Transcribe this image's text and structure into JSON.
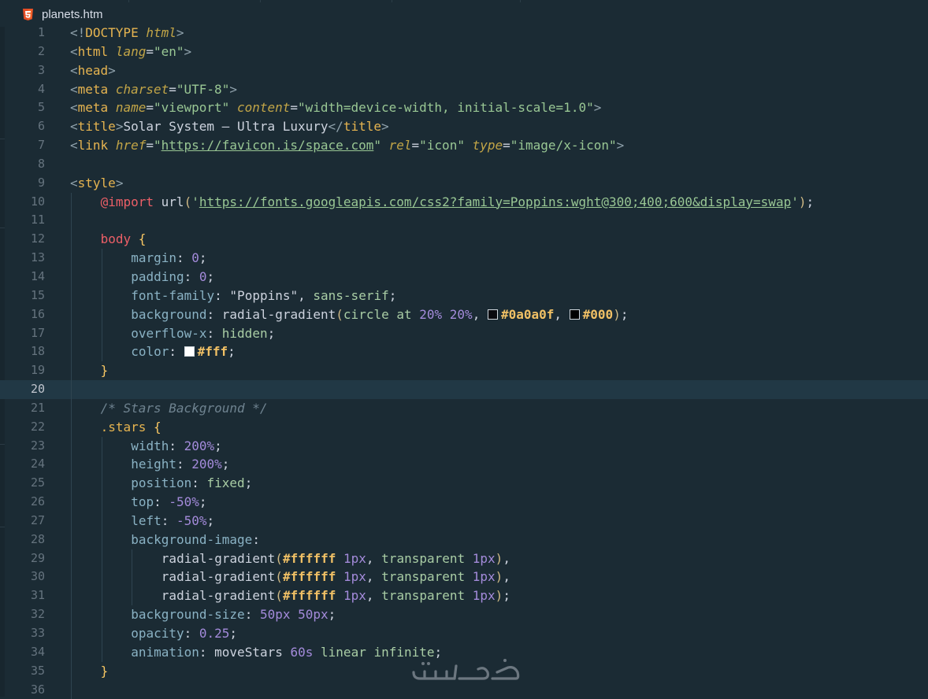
{
  "tab": {
    "title": "planets.htm",
    "icon": "html5-icon"
  },
  "colors": {
    "background": "#1b2b34",
    "current_line": "#213845",
    "line_number": "#65737e",
    "tag": "#e6b450",
    "attribute": "#c2a547",
    "string": "#99c794",
    "property": "#8ab2c4",
    "number": "#a48bdb",
    "hex": "#f0c065",
    "comment": "#6f8390",
    "keyword": "#ec5f67"
  },
  "current_line": 20,
  "lines": [
    {
      "n": "1",
      "tokens": [
        [
          "brk",
          "<!"
        ],
        [
          "tag",
          "DOCTYPE "
        ],
        [
          "attr",
          "html"
        ],
        [
          "brk",
          ">"
        ]
      ]
    },
    {
      "n": "2",
      "tokens": [
        [
          "brk",
          "<"
        ],
        [
          "tag",
          "html "
        ],
        [
          "attr",
          "lang"
        ],
        [
          "plain",
          "="
        ],
        [
          "str",
          "\"en\""
        ],
        [
          "brk",
          ">"
        ]
      ]
    },
    {
      "n": "3",
      "tokens": [
        [
          "brk",
          "<"
        ],
        [
          "tag",
          "head"
        ],
        [
          "brk",
          ">"
        ]
      ]
    },
    {
      "n": "4",
      "tokens": [
        [
          "brk",
          "<"
        ],
        [
          "tag",
          "meta "
        ],
        [
          "attr",
          "charset"
        ],
        [
          "plain",
          "="
        ],
        [
          "str",
          "\"UTF-8\""
        ],
        [
          "brk",
          ">"
        ]
      ]
    },
    {
      "n": "5",
      "tokens": [
        [
          "brk",
          "<"
        ],
        [
          "tag",
          "meta "
        ],
        [
          "attr",
          "name"
        ],
        [
          "plain",
          "="
        ],
        [
          "str",
          "\"viewport\" "
        ],
        [
          "attr",
          "content"
        ],
        [
          "plain",
          "="
        ],
        [
          "str",
          "\"width=device-width, initial-scale=1.0\""
        ],
        [
          "brk",
          ">"
        ]
      ]
    },
    {
      "n": "6",
      "tokens": [
        [
          "brk",
          "<"
        ],
        [
          "tag",
          "title"
        ],
        [
          "brk",
          ">"
        ],
        [
          "plain",
          "Solar System – Ultra Luxury"
        ],
        [
          "brk",
          "</"
        ],
        [
          "tag",
          "title"
        ],
        [
          "brk",
          ">"
        ]
      ]
    },
    {
      "n": "7",
      "tokens": [
        [
          "brk",
          "<"
        ],
        [
          "tag",
          "link "
        ],
        [
          "attr",
          "href"
        ],
        [
          "plain",
          "="
        ],
        [
          "str",
          "\""
        ],
        [
          "url",
          "https://favicon.is/space.com"
        ],
        [
          "str",
          "\" "
        ],
        [
          "attr",
          "rel"
        ],
        [
          "plain",
          "="
        ],
        [
          "str",
          "\"icon\" "
        ],
        [
          "attr",
          "type"
        ],
        [
          "plain",
          "="
        ],
        [
          "str",
          "\"image/x-icon\""
        ],
        [
          "brk",
          ">"
        ]
      ]
    },
    {
      "n": "8",
      "tokens": []
    },
    {
      "n": "9",
      "tokens": [
        [
          "brk",
          "<"
        ],
        [
          "tag",
          "style"
        ],
        [
          "brk",
          ">"
        ]
      ]
    },
    {
      "n": "10",
      "indent": 1,
      "tokens": [
        [
          "kw",
          "@import "
        ],
        [
          "fn",
          "url"
        ],
        [
          "paren",
          "("
        ],
        [
          "str",
          "'"
        ],
        [
          "url",
          "https://fonts.googleapis.com/css2?family=Poppins:wght@300;400;600&display=swap"
        ],
        [
          "str",
          "'"
        ],
        [
          "paren",
          ")"
        ],
        [
          "plain",
          ";"
        ]
      ]
    },
    {
      "n": "11",
      "tokens": []
    },
    {
      "n": "12",
      "indent": 1,
      "tokens": [
        [
          "kw",
          "body "
        ],
        [
          "brace",
          "{"
        ]
      ]
    },
    {
      "n": "13",
      "indent": 2,
      "tokens": [
        [
          "prop",
          "margin"
        ],
        [
          "plain",
          ": "
        ],
        [
          "num",
          "0"
        ],
        [
          "plain",
          ";"
        ]
      ]
    },
    {
      "n": "14",
      "indent": 2,
      "tokens": [
        [
          "prop",
          "padding"
        ],
        [
          "plain",
          ": "
        ],
        [
          "num",
          "0"
        ],
        [
          "plain",
          ";"
        ]
      ]
    },
    {
      "n": "15",
      "indent": 2,
      "tokens": [
        [
          "prop",
          "font-family"
        ],
        [
          "plain",
          ": "
        ],
        [
          "plain",
          "\"Poppins\", "
        ],
        [
          "val",
          "sans-serif"
        ],
        [
          "plain",
          ";"
        ]
      ]
    },
    {
      "n": "16",
      "indent": 2,
      "tokens": [
        [
          "prop",
          "background"
        ],
        [
          "plain",
          ": "
        ],
        [
          "fn",
          "radial-gradient"
        ],
        [
          "paren",
          "("
        ],
        [
          "val",
          "circle at "
        ],
        [
          "num",
          "20% 20%"
        ],
        [
          "plain",
          ", "
        ],
        [
          "swatch",
          "#0a0a0f"
        ],
        [
          "hex",
          "#0a0a0f"
        ],
        [
          "plain",
          ", "
        ],
        [
          "swatch",
          "#000"
        ],
        [
          "hex",
          "#000"
        ],
        [
          "paren",
          ")"
        ],
        [
          "plain",
          ";"
        ]
      ]
    },
    {
      "n": "17",
      "indent": 2,
      "tokens": [
        [
          "prop",
          "overflow-x"
        ],
        [
          "plain",
          ": "
        ],
        [
          "val",
          "hidden"
        ],
        [
          "plain",
          ";"
        ]
      ]
    },
    {
      "n": "18",
      "indent": 2,
      "tokens": [
        [
          "prop",
          "color"
        ],
        [
          "plain",
          ": "
        ],
        [
          "swatch",
          "#ffffff"
        ],
        [
          "hex",
          "#fff"
        ],
        [
          "plain",
          ";"
        ]
      ]
    },
    {
      "n": "19",
      "indent": 1,
      "tokens": [
        [
          "brace",
          "}"
        ]
      ]
    },
    {
      "n": "20",
      "tokens": []
    },
    {
      "n": "21",
      "indent": 1,
      "tokens": [
        [
          "comment",
          "/* Stars Background */"
        ]
      ]
    },
    {
      "n": "22",
      "indent": 1,
      "tokens": [
        [
          "sel",
          ".stars "
        ],
        [
          "brace",
          "{"
        ]
      ]
    },
    {
      "n": "23",
      "indent": 2,
      "tokens": [
        [
          "prop",
          "width"
        ],
        [
          "plain",
          ": "
        ],
        [
          "num",
          "200%"
        ],
        [
          "plain",
          ";"
        ]
      ]
    },
    {
      "n": "24",
      "indent": 2,
      "tokens": [
        [
          "prop",
          "height"
        ],
        [
          "plain",
          ": "
        ],
        [
          "num",
          "200%"
        ],
        [
          "plain",
          ";"
        ]
      ]
    },
    {
      "n": "25",
      "indent": 2,
      "tokens": [
        [
          "prop",
          "position"
        ],
        [
          "plain",
          ": "
        ],
        [
          "val",
          "fixed"
        ],
        [
          "plain",
          ";"
        ]
      ]
    },
    {
      "n": "26",
      "indent": 2,
      "tokens": [
        [
          "prop",
          "top"
        ],
        [
          "plain",
          ": "
        ],
        [
          "num",
          "-50%"
        ],
        [
          "plain",
          ";"
        ]
      ]
    },
    {
      "n": "27",
      "indent": 2,
      "tokens": [
        [
          "prop",
          "left"
        ],
        [
          "plain",
          ": "
        ],
        [
          "num",
          "-50%"
        ],
        [
          "plain",
          ";"
        ]
      ]
    },
    {
      "n": "28",
      "indent": 2,
      "tokens": [
        [
          "prop",
          "background-image"
        ],
        [
          "plain",
          ":"
        ]
      ]
    },
    {
      "n": "29",
      "indent": 3,
      "tokens": [
        [
          "fn",
          "radial-gradient"
        ],
        [
          "paren",
          "("
        ],
        [
          "hex",
          "#ffffff "
        ],
        [
          "num",
          "1px"
        ],
        [
          "plain",
          ", "
        ],
        [
          "val",
          "transparent "
        ],
        [
          "num",
          "1px"
        ],
        [
          "paren",
          ")"
        ],
        [
          "plain",
          ","
        ]
      ]
    },
    {
      "n": "30",
      "indent": 3,
      "tokens": [
        [
          "fn",
          "radial-gradient"
        ],
        [
          "paren",
          "("
        ],
        [
          "hex",
          "#ffffff "
        ],
        [
          "num",
          "1px"
        ],
        [
          "plain",
          ", "
        ],
        [
          "val",
          "transparent "
        ],
        [
          "num",
          "1px"
        ],
        [
          "paren",
          ")"
        ],
        [
          "plain",
          ","
        ]
      ]
    },
    {
      "n": "31",
      "indent": 3,
      "tokens": [
        [
          "fn",
          "radial-gradient"
        ],
        [
          "paren",
          "("
        ],
        [
          "hex",
          "#ffffff "
        ],
        [
          "num",
          "1px"
        ],
        [
          "plain",
          ", "
        ],
        [
          "val",
          "transparent "
        ],
        [
          "num",
          "1px"
        ],
        [
          "paren",
          ")"
        ],
        [
          "plain",
          ";"
        ]
      ]
    },
    {
      "n": "32",
      "indent": 2,
      "tokens": [
        [
          "prop",
          "background-size"
        ],
        [
          "plain",
          ": "
        ],
        [
          "num",
          "50px 50px"
        ],
        [
          "plain",
          ";"
        ]
      ]
    },
    {
      "n": "33",
      "indent": 2,
      "tokens": [
        [
          "prop",
          "opacity"
        ],
        [
          "plain",
          ": "
        ],
        [
          "num",
          "0.25"
        ],
        [
          "plain",
          ";"
        ]
      ]
    },
    {
      "n": "34",
      "indent": 2,
      "tokens": [
        [
          "prop",
          "animation"
        ],
        [
          "plain",
          ": "
        ],
        [
          "fn",
          "moveStars "
        ],
        [
          "num",
          "60s"
        ],
        [
          "plain",
          " "
        ],
        [
          "val",
          "linear infinite"
        ],
        [
          "plain",
          ";"
        ]
      ]
    },
    {
      "n": "35",
      "indent": 1,
      "tokens": [
        [
          "brace",
          "}"
        ]
      ]
    },
    {
      "n": "36",
      "tokens": []
    }
  ],
  "watermark": {
    "text": "خمسات"
  }
}
